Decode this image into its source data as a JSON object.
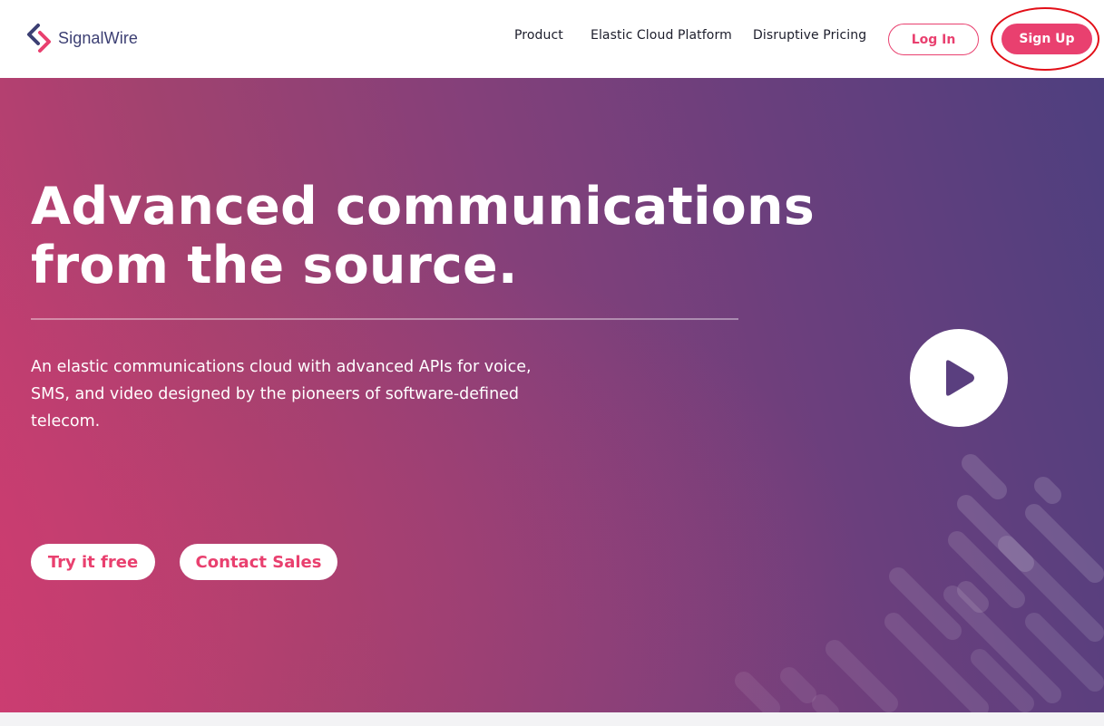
{
  "header": {
    "logo_text": "SignalWire",
    "nav": [
      "Product",
      "Elastic Cloud Platform",
      "Disruptive Pricing"
    ],
    "login_label": "Log In",
    "signup_label": "Sign Up"
  },
  "hero": {
    "headline_line1": "Advanced communications",
    "headline_line2": "from the source.",
    "subtext": "An elastic communications cloud with advanced APIs for voice, SMS, and video designed by the pioneers of software-defined telecom.",
    "try_label": "Try it free",
    "contact_label": "Contact Sales"
  },
  "colors": {
    "accent": "#e9406f",
    "logo_navy": "#3c3f73",
    "highlight_ring": "#e20f18"
  },
  "icons": [
    "signalwire-logo-icon",
    "play-icon"
  ]
}
